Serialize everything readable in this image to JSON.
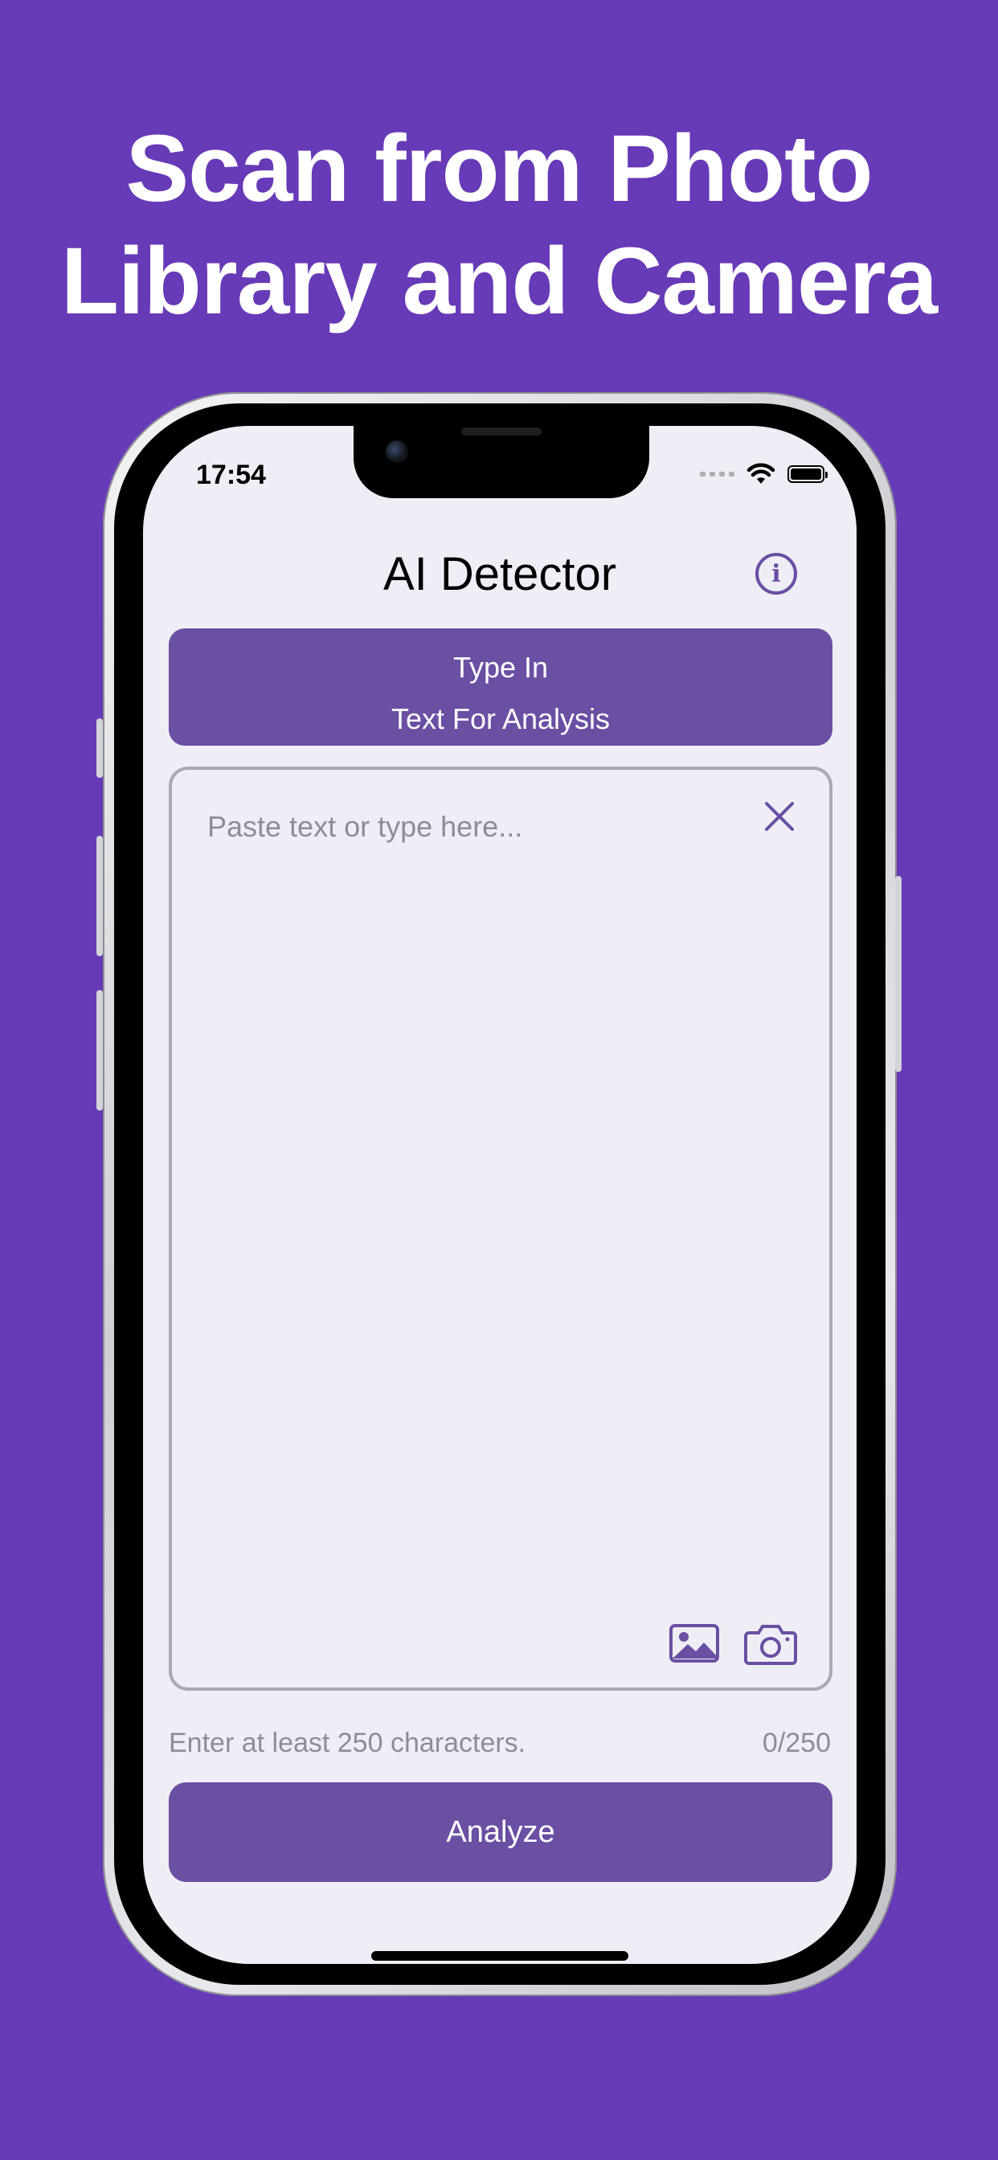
{
  "headline": {
    "line1": "Scan from Photo",
    "line2": "Library and Camera"
  },
  "status_bar": {
    "time": "17:54"
  },
  "nav": {
    "title": "AI Detector",
    "info_icon": "info-circle-icon"
  },
  "mode_banner": {
    "line1": "Type In",
    "line2": "Text For Analysis"
  },
  "text_input": {
    "placeholder": "Paste text or type here...",
    "value": ""
  },
  "input_actions": {
    "clear_icon": "close-icon",
    "photo_icon": "photo-library-icon",
    "camera_icon": "camera-icon"
  },
  "footer": {
    "hint": "Enter at least 250 characters.",
    "counter": "0/250"
  },
  "analyze_button": {
    "label": "Analyze"
  },
  "colors": {
    "background": "#673AB7",
    "accent": "#6A4FA3",
    "screen": "#EFEEF6"
  }
}
